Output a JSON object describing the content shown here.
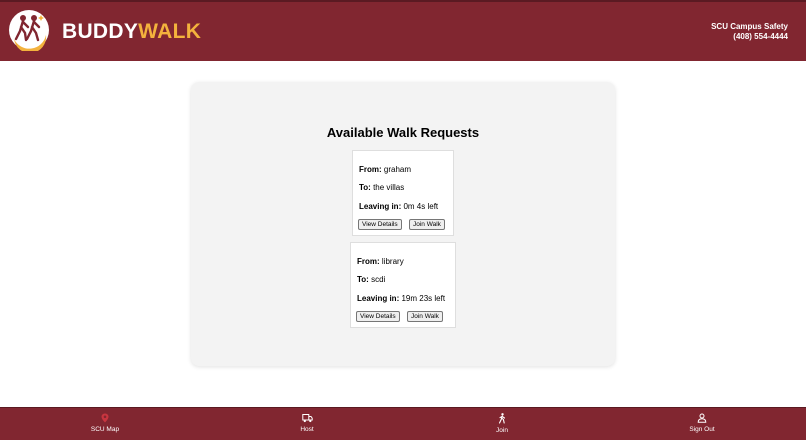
{
  "header": {
    "brand_part1": "BUDDY",
    "brand_part2": "WALK",
    "safety_name": "SCU Campus Safety",
    "safety_phone": "(408) 554-4444",
    "logo_icon": "walking-buddies-logo-icon"
  },
  "main": {
    "title": "Available Walk Requests",
    "from_label": "From:",
    "to_label": "To:",
    "leaving_label": "Leaving in:",
    "requests": [
      {
        "from": "graham",
        "to": "the villas",
        "leaving": "0m 4s left",
        "details_label": "View Details",
        "join_label": "Join Walk"
      },
      {
        "from": "library",
        "to": "scdi",
        "leaving": "19m 23s left",
        "details_label": "View Details",
        "join_label": "Join Walk"
      }
    ]
  },
  "nav": {
    "items": [
      {
        "label": "SCU Map",
        "icon": "map-pin-icon"
      },
      {
        "label": "Host",
        "icon": "truck-icon"
      },
      {
        "label": "Join",
        "icon": "walking-person-icon"
      },
      {
        "label": "Sign Out",
        "icon": "user-icon"
      }
    ]
  },
  "colors": {
    "brand": "#812630",
    "accent": "#f3b23d",
    "map_pin": "#c8353f",
    "panel": "#f3f3f3"
  }
}
